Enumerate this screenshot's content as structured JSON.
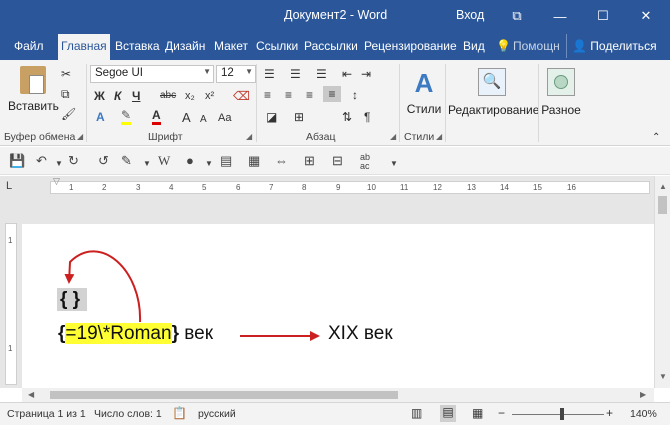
{
  "window": {
    "doc_title": "Документ2 - Word",
    "signin": "Вход",
    "minimize": "—",
    "maximize": "☐",
    "close": "✕",
    "ribbon_display": "⧉"
  },
  "tabs": [
    "Файл",
    "Главная",
    "Вставка",
    "Дизайн",
    "Макет",
    "Ссылки",
    "Рассылки",
    "Рецензирование",
    "Вид"
  ],
  "help": "Помощн",
  "share": "Поделиться",
  "ribbon": {
    "paste": "Вставить",
    "clipboard": "Буфер обмена",
    "font_name": "Segoe UI",
    "font_size": "12",
    "font_group": "Шрифт",
    "bold": "Ж",
    "italic": "К",
    "underline": "Ч",
    "strike": "abc",
    "sub": "x₂",
    "sup": "x²",
    "font_color": "A",
    "aa_up": "A",
    "aa_down": "A",
    "case": "Aa",
    "paragraph_group": "Абзац",
    "pilcrow": "¶",
    "styles": "Стили",
    "styles_group": "Стили",
    "editing": "Редактирование",
    "share_item": "Разное"
  },
  "ruler_numbers": [
    "1",
    "2",
    "3",
    "4",
    "5",
    "6",
    "7",
    "8",
    "9",
    "10",
    "11",
    "12",
    "13",
    "14",
    "15",
    "16"
  ],
  "document": {
    "empty_braces": "{  }",
    "field_code": "=19\\*Roman",
    "open_brace": "{",
    "close_brace": "}",
    "suffix": "век",
    "result": "XIX век"
  },
  "status": {
    "page": "Страница 1 из 1",
    "words": "Число слов: 1",
    "language": "русский",
    "zoom": "140%"
  },
  "colors": {
    "accent": "#2b579a",
    "highlight": "#ffff33",
    "arrow": "#cc1f1f"
  }
}
